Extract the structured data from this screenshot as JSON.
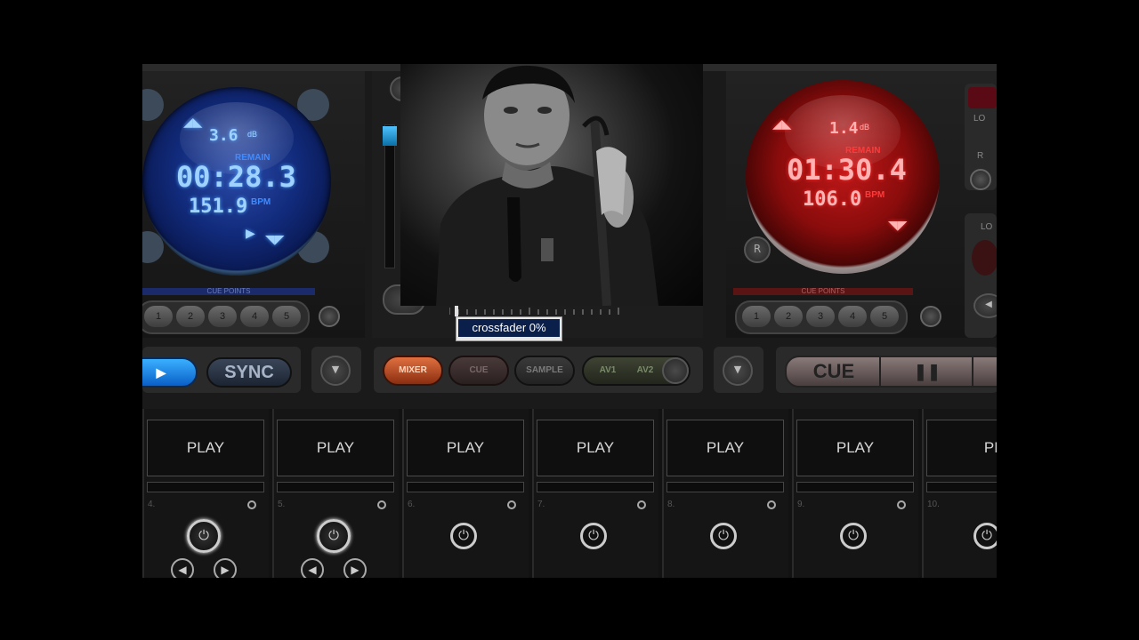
{
  "colors": {
    "left_accent": "#3f8cff",
    "right_accent": "#ff2a2a",
    "mixer_btn": "#c7542a"
  },
  "left_deck": {
    "pitch": "3.6",
    "pitch_unit": "dB",
    "remain_label": "REMAIN",
    "time": "00:28.3",
    "bpm": "151.9",
    "bpm_label": "BPM",
    "play_glyph": "▶",
    "cue_points_title": "CUE POINTS",
    "cue_points": [
      "1",
      "2",
      "3",
      "4",
      "5"
    ]
  },
  "right_deck": {
    "pitch": "1.4",
    "pitch_unit": "dB",
    "remain_label": "REMAIN",
    "time": "01:30.4",
    "bpm": "106.0",
    "bpm_label": "BPM",
    "corner_label": "R",
    "cue_points_title": "CUE POINTS",
    "cue_points": [
      "1",
      "2",
      "3",
      "4",
      "5"
    ],
    "side_labels": [
      "LO",
      "R",
      "LO"
    ]
  },
  "tooltip": "crossfader 0%",
  "crossfader_value": 0,
  "controls": {
    "sync_label": "SYNC",
    "menu_glyph": "▼",
    "mixer_label": "MIXER",
    "cue_tab_label": "CUE",
    "sample_label": "SAMPLE",
    "av1_label": "AV1",
    "av2_label": "AV2",
    "cue_label": "CUE",
    "pause_glyph": "❚❚"
  },
  "pads": [
    {
      "label": "PLAY",
      "num": "4."
    },
    {
      "label": "PLAY",
      "num": "5."
    },
    {
      "label": "PLAY",
      "num": "6."
    },
    {
      "label": "PLAY",
      "num": "7."
    },
    {
      "label": "PLAY",
      "num": "8."
    },
    {
      "label": "PLAY",
      "num": "9."
    },
    {
      "label": "PLAY",
      "num": "10."
    }
  ],
  "icons": {
    "power": "⏻",
    "prev": "◀",
    "next": "▶"
  }
}
